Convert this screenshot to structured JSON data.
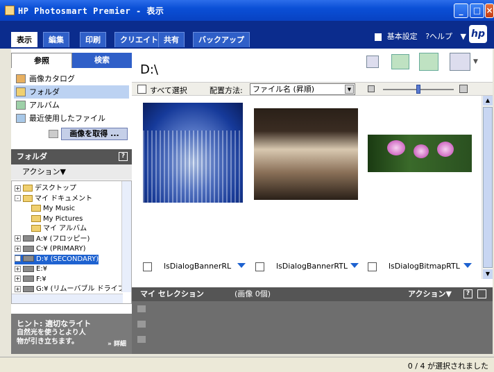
{
  "window": {
    "title": "HP Photosmart Premier - 表示"
  },
  "menu": {
    "tabs": [
      "表示",
      "編集",
      "印刷",
      "クリエイト",
      "共有",
      "バックアップ"
    ],
    "settings": "基本設定",
    "help": "?ヘルプ",
    "logo": "hp"
  },
  "left": {
    "subtabs": [
      "参照",
      "検索"
    ],
    "nav_items": [
      "画像カタログ",
      "フォルダ",
      "アルバム",
      "最近使用したファイル"
    ],
    "get_images_button": "画像を取得 ...",
    "folder_panel_title": "フォルダ",
    "folder_panel_help": "?",
    "actions_label": "アクション▼",
    "tree": [
      {
        "label": "デスクトップ",
        "depth": 0,
        "kind": "folder",
        "expander": "+"
      },
      {
        "label": "マイ ドキュメント",
        "depth": 0,
        "kind": "folder",
        "expander": "-"
      },
      {
        "label": "My Music",
        "depth": 1,
        "kind": "folder",
        "expander": ""
      },
      {
        "label": "My Pictures",
        "depth": 1,
        "kind": "folder",
        "expander": ""
      },
      {
        "label": "マイ アルバム",
        "depth": 1,
        "kind": "folder",
        "expander": ""
      },
      {
        "label": "A:¥ (フロッピー)",
        "depth": 0,
        "kind": "drive",
        "expander": "+"
      },
      {
        "label": "C:¥ (PRIMARY)",
        "depth": 0,
        "kind": "drive",
        "expander": "+"
      },
      {
        "label": "D:¥ (SECONDARY)",
        "depth": 0,
        "kind": "drive",
        "expander": "+",
        "selected": true
      },
      {
        "label": "E:¥",
        "depth": 0,
        "kind": "drive",
        "expander": "+"
      },
      {
        "label": "F:¥",
        "depth": 0,
        "kind": "drive",
        "expander": "+"
      },
      {
        "label": "G:¥ (リムーバブル ドライブ",
        "depth": 0,
        "kind": "drive",
        "expander": "+"
      }
    ],
    "hint_title": "ヒント: 適切なライト",
    "hint_body": "自然光を使うとより人物が引き立ちます。",
    "hint_more": "» 詳細"
  },
  "main": {
    "path": "D:\\",
    "select_all": "すべて選択",
    "sort_label": "配置方法:",
    "sort_value": "ファイル名 (昇順)",
    "thumbnails": [
      {
        "name": "lsDialogBannerRL"
      },
      {
        "name": "lsDialogBannerRTL"
      },
      {
        "name": "lsDialogBitmapRTL"
      }
    ],
    "selection_title": "マイ セレクション",
    "selection_count": "(画像 0個)",
    "selection_actions": "アクション▼",
    "selection_help": "?"
  },
  "status": {
    "text": "0 / 4 が選択されました"
  },
  "colors": {
    "titlebar": "#0a4fd6",
    "menubar": "#0b2c8d",
    "accent": "#1e62d0"
  }
}
